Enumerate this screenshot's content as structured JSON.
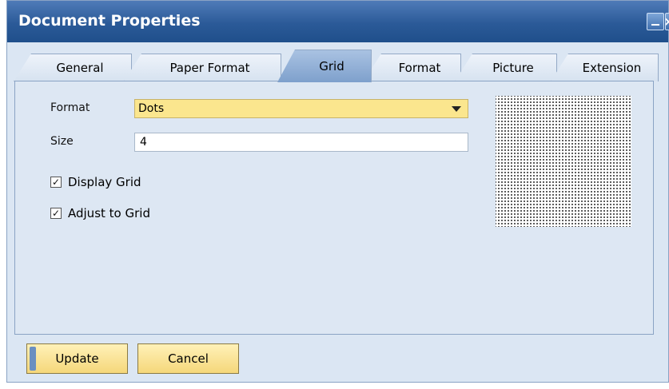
{
  "window": {
    "title": "Document Properties",
    "title_buttons": [
      "minimize-icon",
      "close-icon"
    ],
    "colors": {
      "title_bar": "#2b5a98",
      "body": "#dbe6f3",
      "field_highlight": "#fbe68e",
      "button": "#f5d77a"
    }
  },
  "tabs": [
    {
      "label": "General",
      "active": false
    },
    {
      "label": "Paper Format",
      "active": false
    },
    {
      "label": "Grid",
      "active": true
    },
    {
      "label": "Format",
      "active": false
    },
    {
      "label": "Picture",
      "active": false
    },
    {
      "label": "Extension",
      "active": false
    }
  ],
  "form": {
    "format_label": "Format",
    "format_value": "Dots",
    "size_label": "Size",
    "size_value": "4",
    "display_grid_label": "Display Grid",
    "display_grid_checked": true,
    "adjust_grid_label": "Adjust to Grid",
    "adjust_grid_checked": true
  },
  "preview": {
    "pattern": "dots"
  },
  "footer": {
    "update_label": "Update",
    "cancel_label": "Cancel"
  }
}
